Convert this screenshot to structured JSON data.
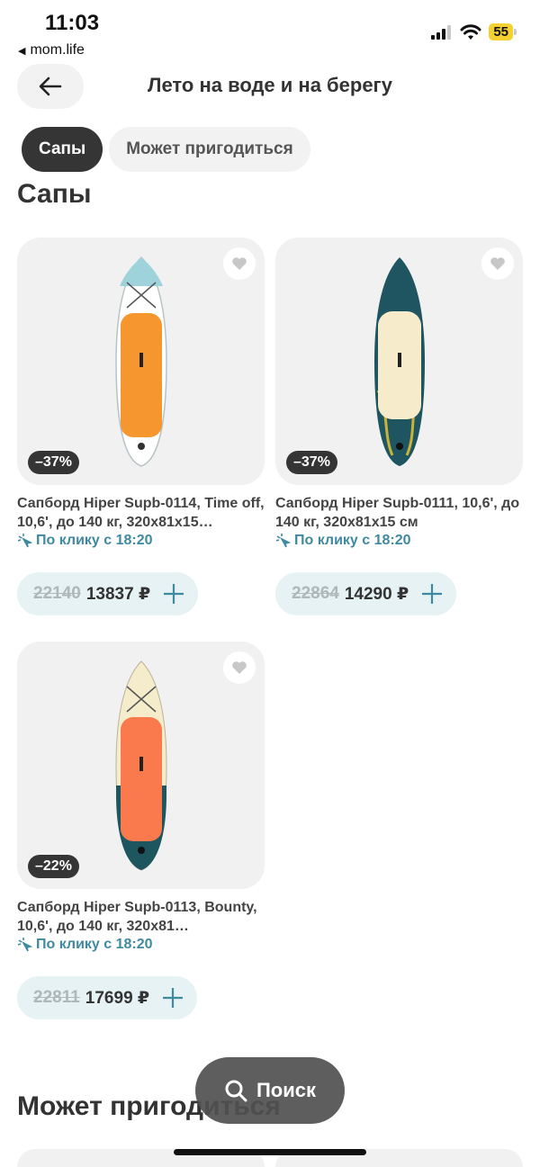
{
  "status": {
    "time": "11:03",
    "back_app": "mom.life",
    "battery": "55"
  },
  "header": {
    "title": "Лето на воде и на берегу"
  },
  "tabs": [
    {
      "label": "Сапы"
    },
    {
      "label": "Может пригодиться"
    }
  ],
  "sections": {
    "saps_title": "Сапы",
    "maybe_title": "Может пригодиться"
  },
  "products": [
    {
      "name": "Сапборд Hiper Supb-0114, Time off, 10,6', до 140 кг, 320x81x15…",
      "delivery": "По клику с 18:20",
      "discount": "–37%",
      "old_price": "22140",
      "price": "13837 ₽"
    },
    {
      "name": "Сапборд Hiper Supb-0111, 10,6', до 140 кг, 320x81x15 см",
      "delivery": "По клику с 18:20",
      "discount": "–37%",
      "old_price": "22864",
      "price": "14290 ₽"
    },
    {
      "name": "Сапборд Hiper Supb-0113, Bounty, 10,6', до 140 кг, 320x81…",
      "delivery": "По клику с 18:20",
      "discount": "–22%",
      "old_price": "22811",
      "price": "17699 ₽"
    }
  ],
  "search": {
    "label": "Поиск"
  },
  "colors": {
    "accent": "#3f8aa1",
    "dark": "#353535",
    "pill": "#e6f2f4"
  }
}
